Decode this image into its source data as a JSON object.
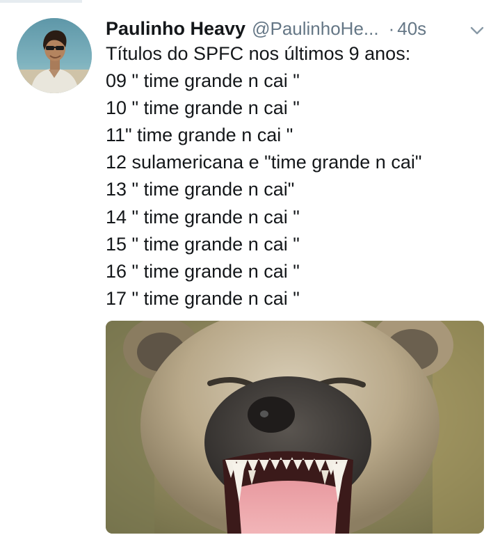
{
  "tweet": {
    "display_name": "Paulinho Heavy",
    "handle": "@PaulinhoHe...",
    "separator": "·",
    "timestamp": "40s",
    "lines": [
      "Títulos do SPFC nos últimos 9 anos:",
      "09 \" time grande n cai \"",
      "10 \" time grande n cai \"",
      "11\" time grande n cai \"",
      "12 sulamericana e \"time grande n cai\"",
      "13 \" time grande n cai\"",
      "14 \" time grande n cai \"",
      "15 \" time grande n cai \"",
      "16 \" time grande n cai \"",
      "17 \" time grande n cai \""
    ]
  },
  "icons": {
    "avatar": "avatar-photo",
    "menu": "chevron-down-icon"
  },
  "colors": {
    "text": "#14171a",
    "secondary": "#657786"
  }
}
